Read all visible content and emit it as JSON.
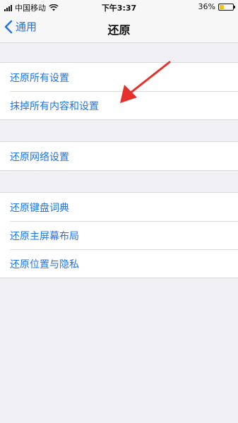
{
  "status": {
    "carrier": "中国移动",
    "time": "下午3:37",
    "battery": "36%",
    "battery_level": 0.36
  },
  "nav": {
    "back_label": "通用",
    "title": "还原"
  },
  "groups": [
    {
      "items": [
        {
          "label": "还原所有设置"
        },
        {
          "label": "抹掉所有内容和设置"
        }
      ]
    },
    {
      "items": [
        {
          "label": "还原网络设置"
        }
      ]
    },
    {
      "items": [
        {
          "label": "还原键盘词典"
        },
        {
          "label": "还原主屏幕布局"
        },
        {
          "label": "还原位置与隐私"
        }
      ]
    }
  ],
  "colors": {
    "accent": "#1e74e8",
    "annotation_arrow": "#e8302a",
    "background": "#efeff4"
  },
  "icons": {
    "back": "chevron-left-icon",
    "annotation": "red-arrow-icon"
  }
}
